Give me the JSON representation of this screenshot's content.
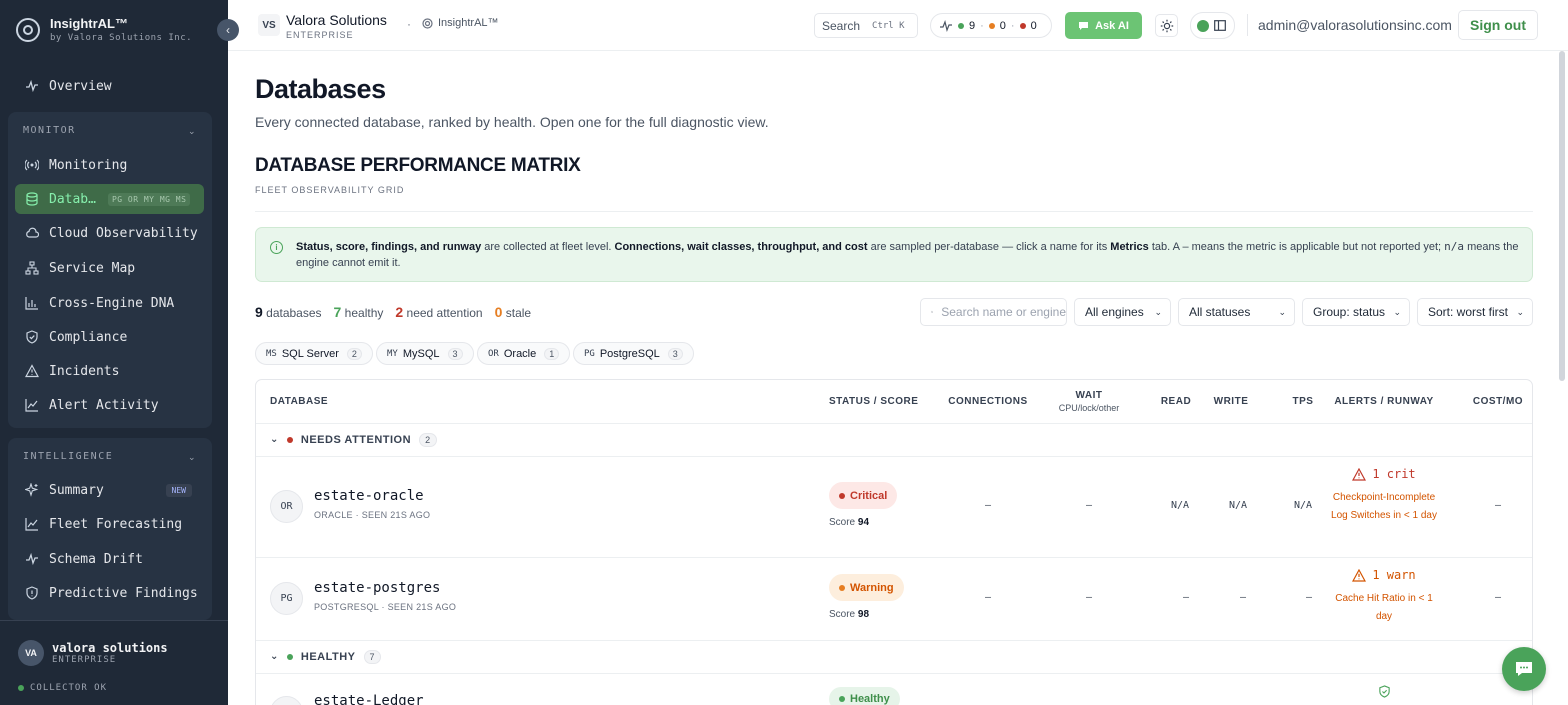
{
  "brand": {
    "name": "InsightrAL™",
    "sub": "by Valora Solutions Inc."
  },
  "sidebar": {
    "overview": "Overview",
    "monitor_label": "MONITOR",
    "monitor_items": [
      "Monitoring",
      "Datab…",
      "Cloud Observability",
      "Service Map",
      "Cross-Engine DNA",
      "Compliance",
      "Incidents",
      "Alert Activity"
    ],
    "database_engines": "PG OR MY MG MS",
    "intelligence_label": "INTELLIGENCE",
    "intelligence_items": [
      "Summary",
      "Fleet Forecasting",
      "Schema Drift",
      "Predictive Findings"
    ],
    "new_badge": "NEW",
    "org_initials": "VA",
    "org_name": "valora solutions",
    "org_plan": "ENTERPRISE",
    "collector_status": "COLLECTOR OK"
  },
  "topbar": {
    "org_chip": "VS",
    "org_name": "Valora Solutions",
    "org_plan": "ENTERPRISE",
    "separator": "·",
    "app_name": "InsightrAL™",
    "search_label": "Search",
    "search_kbd": "Ctrl K",
    "status_counts": {
      "healthy": "9",
      "warn": "0",
      "crit": "0"
    },
    "status_sep": "·",
    "ask_ai": "Ask AI",
    "email": "admin@valorasolutionsinc.com",
    "sign_out": "Sign out"
  },
  "colors": {
    "accent": "#4aa35a",
    "critical": "#c0392b",
    "warning": "#e67e22",
    "sidebar": "#1f2937"
  },
  "page": {
    "title": "Databases",
    "subtitle": "Every connected database, ranked by health. Open one for the full diagnostic view.",
    "matrix_title": "DATABASE PERFORMANCE MATRIX",
    "matrix_sub": "FLEET OBSERVABILITY GRID"
  },
  "info": {
    "b1": "Status, score, findings, and runway",
    "t1": " are collected at fleet level. ",
    "b2": "Connections, wait classes, throughput, and cost",
    "t2": " are sampled per-database — click a name for its ",
    "b3": "Metrics",
    "t3": " tab. A – means the metric is applicable but not reported yet; ",
    "na": "n/a",
    "t4": " means the engine cannot emit it."
  },
  "summary": {
    "total": "9",
    "total_label": "databases",
    "healthy": "7",
    "healthy_label": "healthy",
    "attention": "2",
    "attention_label": "need attention",
    "stale": "0",
    "stale_label": "stale"
  },
  "filters": {
    "search_placeholder": "Search name or engine",
    "engines": "All engines",
    "statuses": "All statuses",
    "group": "Group: status",
    "sort": "Sort: worst first"
  },
  "engine_pills": [
    {
      "code": "MS",
      "name": "SQL Server",
      "count": "2"
    },
    {
      "code": "MY",
      "name": "MySQL",
      "count": "3"
    },
    {
      "code": "OR",
      "name": "Oracle",
      "count": "1"
    },
    {
      "code": "PG",
      "name": "PostgreSQL",
      "count": "3"
    }
  ],
  "table": {
    "headers": {
      "database": "DATABASE",
      "status": "STATUS / SCORE",
      "connections": "CONNECTIONS",
      "wait": "WAIT",
      "wait_sub": "CPU/lock/other",
      "read": "READ",
      "write": "WRITE",
      "tps": "TPS",
      "alerts": "ALERTS / RUNWAY",
      "cost": "COST/MO"
    },
    "groups": [
      {
        "label": "NEEDS ATTENTION",
        "count": "2"
      },
      {
        "label": "HEALTHY",
        "count": "7"
      }
    ],
    "rows": [
      {
        "badge": "OR",
        "name": "estate-oracle",
        "meta": "ORACLE · SEEN 21S AGO",
        "status": "Critical",
        "score_label": "Score",
        "score": "94",
        "connections": "–",
        "wait": "–",
        "read": "N/A",
        "write": "N/A",
        "tps": "N/A",
        "alert_head": "1 crit",
        "alert_desc": "Checkpoint-Incomplete Log Switches in < 1 day",
        "cost": "–"
      },
      {
        "badge": "PG",
        "name": "estate-postgres",
        "meta": "POSTGRESQL · SEEN 21S AGO",
        "status": "Warning",
        "score_label": "Score",
        "score": "98",
        "connections": "–",
        "wait": "–",
        "read": "–",
        "write": "–",
        "tps": "–",
        "alert_head": "1 warn",
        "alert_desc": "Cache Hit Ratio in < 1 day",
        "cost": "–"
      },
      {
        "name": "estate-Ledger",
        "status": "Healthy"
      }
    ]
  }
}
